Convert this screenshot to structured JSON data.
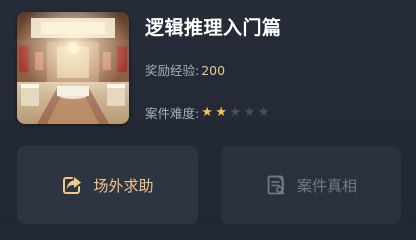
{
  "case": {
    "title": "逻辑推理入门篇",
    "reward_label": "奖励经验:",
    "reward_value": "200",
    "difficulty_label": "案件难度:",
    "difficulty_level": 2,
    "difficulty_max": 5,
    "thumbnail_icon": "jewelry-store-interior-image"
  },
  "actions": {
    "help_label": "场外求助",
    "help_icon": "share-icon",
    "truth_label": "案件真相",
    "truth_icon": "document-icon"
  },
  "colors": {
    "background": "#232a36",
    "accent": "#f0c988",
    "star_filled": "#f3c350",
    "star_empty": "#4a515d",
    "disabled_text": "#737a86"
  }
}
